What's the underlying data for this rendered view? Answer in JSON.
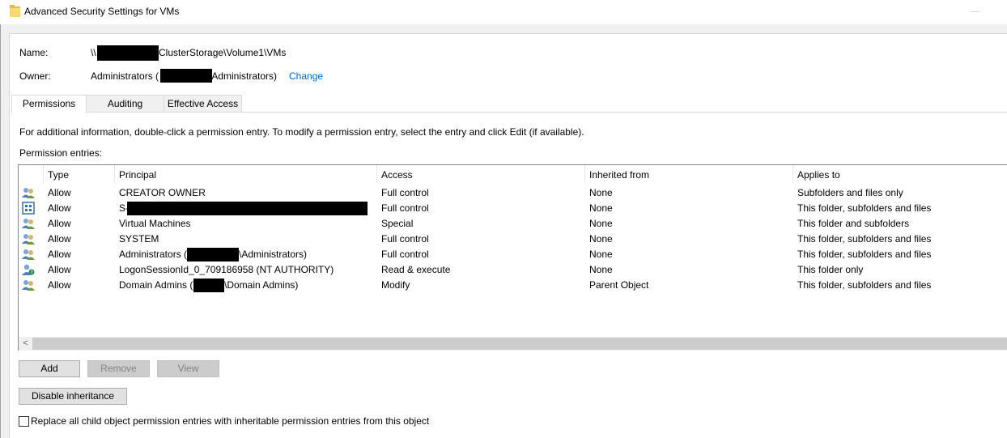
{
  "window": {
    "title": "Advanced Security Settings for VMs"
  },
  "name_row": {
    "label": "Name:",
    "prefix": "\\\\",
    "value_suffix": "ClusterStorage\\Volume1\\VMs"
  },
  "owner_row": {
    "label": "Owner:",
    "value_prefix": "Administrators (",
    "value_suffix": "\\Administrators)",
    "change_link": "Change"
  },
  "tabs": [
    {
      "label": "Permissions",
      "active": true
    },
    {
      "label": "Auditing",
      "active": false
    },
    {
      "label": "Effective Access",
      "active": false
    }
  ],
  "info_text": "For additional information, double-click a permission entry. To modify a permission entry, select the entry and click Edit (if available).",
  "entries_label": "Permission entries:",
  "table": {
    "headers": {
      "type": "Type",
      "principal": "Principal",
      "access": "Access",
      "inherited_from": "Inherited from",
      "applies_to": "Applies to"
    },
    "rows": [
      {
        "icon": "users-group-icon",
        "type": "Allow",
        "principal": "CREATOR OWNER",
        "access": "Full control",
        "inherited_from": "None",
        "applies_to": "Subfolders and files only"
      },
      {
        "icon": "sid-unknown-icon",
        "type": "Allow",
        "principal": "S-",
        "access": "Full control",
        "inherited_from": "None",
        "applies_to": "This folder, subfolders and files"
      },
      {
        "icon": "users-group-icon",
        "type": "Allow",
        "principal": "Virtual Machines",
        "access": "Special",
        "inherited_from": "None",
        "applies_to": "This folder and subfolders"
      },
      {
        "icon": "users-group-icon",
        "type": "Allow",
        "principal": "SYSTEM",
        "access": "Full control",
        "inherited_from": "None",
        "applies_to": "This folder, subfolders and files"
      },
      {
        "icon": "users-group-icon",
        "type": "Allow",
        "principal": "Administrators (",
        "principal_suffix": "\\Administrators)",
        "access": "Full control",
        "inherited_from": "None",
        "applies_to": "This folder, subfolders and files"
      },
      {
        "icon": "logon-session-icon",
        "type": "Allow",
        "principal": "LogonSessionId_0_709186958 (NT AUTHORITY)",
        "access": "Read & execute",
        "inherited_from": "None",
        "applies_to": "This folder only"
      },
      {
        "icon": "users-group-icon",
        "type": "Allow",
        "principal": "Domain Admins (",
        "principal_suffix": "\\Domain Admins)",
        "access": "Modify",
        "inherited_from": "Parent Object",
        "applies_to": "This folder, subfolders and files"
      }
    ]
  },
  "scroll_left_glyph": "<",
  "buttons": {
    "add": "Add",
    "remove": "Remove",
    "view": "View",
    "disable_inheritance": "Disable inheritance"
  },
  "replace_checkbox": {
    "label": "Replace all child object permission entries with inheritable permission entries from this object",
    "checked": false
  },
  "colors": {
    "link": "#0066cc",
    "panel_bg": "#ffffff",
    "dialog_bg": "#f0f0f0",
    "redaction": "#000000"
  }
}
